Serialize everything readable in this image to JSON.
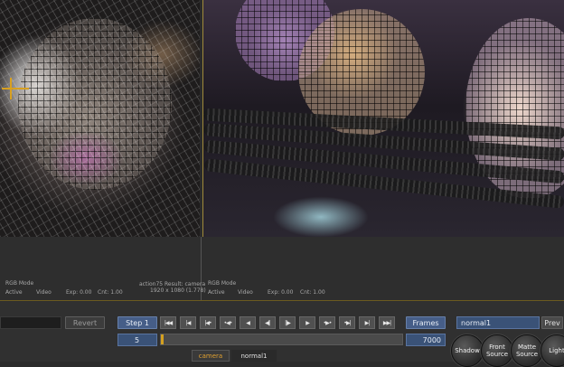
{
  "viewer_left": {
    "mode": "RGB Mode",
    "active_label": "Active",
    "channel": "Video",
    "exposure": "Exp: 0.00",
    "contrast": "Cnt: 1.00",
    "result_label": "action75 Result: camera",
    "resolution": "1920 x 1080 (1.778)"
  },
  "viewer_right": {
    "mode": "RGB Mode",
    "active_label": "Active",
    "channel": "Video",
    "exposure": "Exp: 0.00",
    "contrast": "Cnt: 1.00"
  },
  "controls": {
    "revert_label": "Revert",
    "step_label": "Step 1",
    "current_frame": "5",
    "frames_label": "Frames",
    "total_frames": "7000",
    "node_name": "normal1",
    "prev_label": "Prev",
    "transport": [
      "|◀◀",
      "|◀",
      "|◀•",
      "•◀•",
      "◀",
      "◀||",
      "||▶",
      "▶",
      "•▶•",
      "•▶|",
      "▶|",
      "▶▶|"
    ],
    "tabs": [
      "camera",
      "normal1"
    ],
    "round_buttons": [
      "Shadow",
      "Front Source",
      "Matte Source",
      "Light"
    ]
  }
}
